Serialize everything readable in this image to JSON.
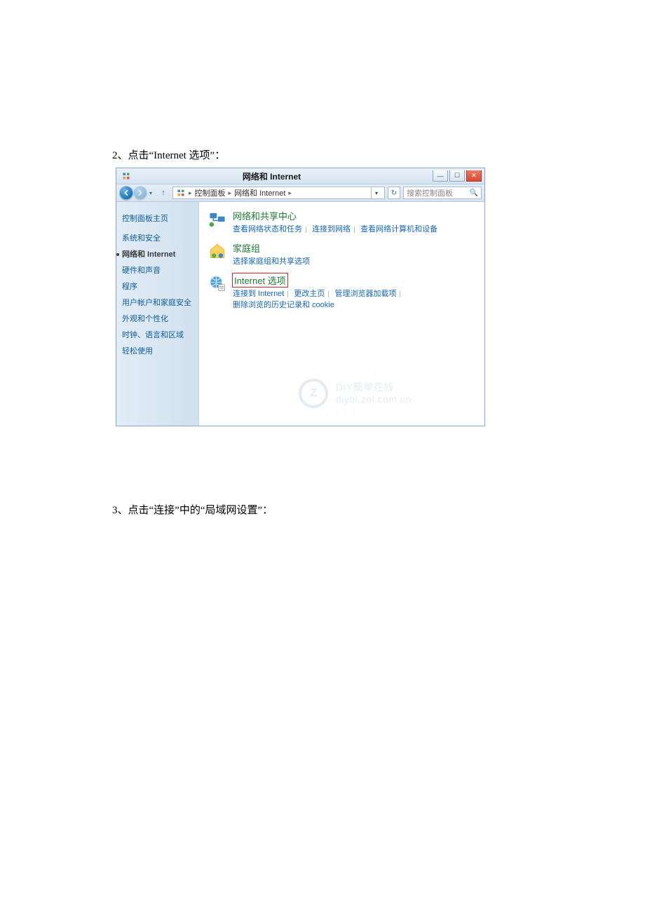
{
  "step2": "2、点击“Internet 选项”：",
  "step3": "3、点击“连接”中的“局域网设置”：",
  "window": {
    "title": "网络和 Internet",
    "btn_min": "—",
    "btn_max": "☐",
    "btn_close": "✕",
    "breadcrumb": {
      "part1": "控制面板",
      "part2": "网络和 Internet"
    },
    "search_placeholder": "搜索控制面板"
  },
  "sidebar": {
    "home": "控制面板主页",
    "items": [
      "系统和安全",
      "网络和 Internet",
      "硬件和声音",
      "程序",
      "用户帐户和家庭安全",
      "外观和个性化",
      "时钟、语言和区域",
      "轻松使用"
    ]
  },
  "content": {
    "cat1": {
      "title": "网络和共享中心",
      "sub": [
        "查看网络状态和任务",
        "连接到网络",
        "查看网络计算机和设备"
      ]
    },
    "cat2": {
      "title": "家庭组",
      "sub": [
        "选择家庭组和共享选项"
      ]
    },
    "cat3": {
      "title": "Internet 选项",
      "sub": [
        "连接到 Internet",
        "更改主页",
        "管理浏览器加载项",
        "删除浏览的历史记录和 cookie"
      ]
    }
  },
  "watermark": {
    "line1": "DIY簡単在线",
    "line2": "diybl.zol.com.cn"
  }
}
